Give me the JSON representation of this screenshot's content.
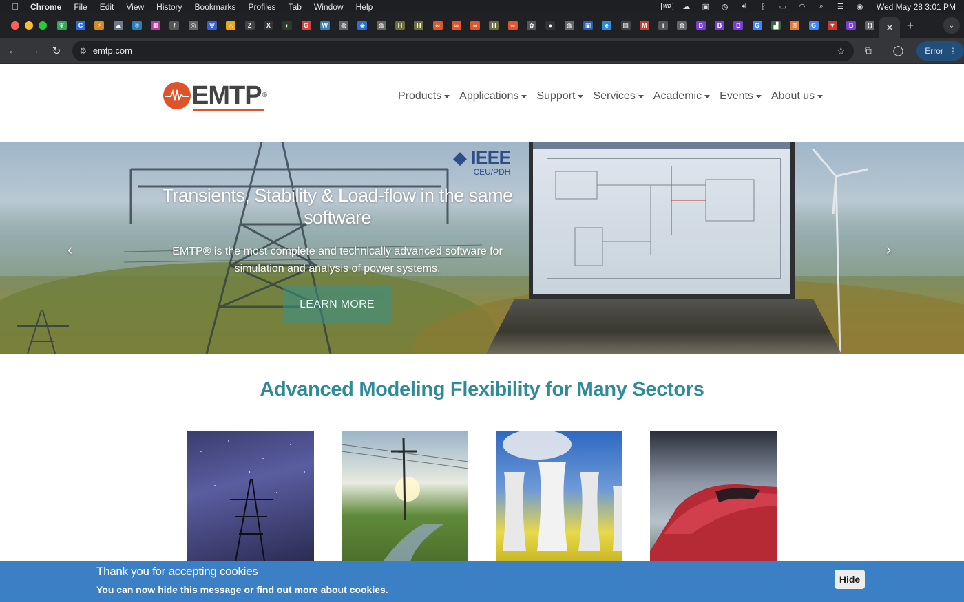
{
  "menubar": {
    "app": "Chrome",
    "items": [
      "File",
      "Edit",
      "View",
      "History",
      "Bookmarks",
      "Profiles",
      "Tab",
      "Window",
      "Help"
    ],
    "clock": "Wed May 28  3:01 PM",
    "wd_label": "WD"
  },
  "tabs": {
    "favicons": [
      {
        "icon": "leaf-icon",
        "color": "#3aa35c",
        "glyph": "❦"
      },
      {
        "icon": "c-icon",
        "color": "#2d6ce0",
        "glyph": "C"
      },
      {
        "icon": "bolt-icon",
        "color": "#d98a1e",
        "glyph": "⚡"
      },
      {
        "icon": "ghost-icon",
        "color": "#6f7a86",
        "glyph": "☁"
      },
      {
        "icon": "react-icon",
        "color": "#2a7fb8",
        "glyph": "⚛"
      },
      {
        "icon": "grid-icon",
        "color": "#b03fa0",
        "glyph": "▦"
      },
      {
        "icon": "slash-icon",
        "color": "#555555",
        "glyph": "/"
      },
      {
        "icon": "circle-icon",
        "color": "#666666",
        "glyph": "◎"
      },
      {
        "icon": "shield-icon",
        "color": "#3a60c9",
        "glyph": "⛨"
      },
      {
        "icon": "drive-icon",
        "color": "#e6a81e",
        "glyph": "△"
      },
      {
        "icon": "z-icon",
        "color": "#444444",
        "glyph": "Z"
      },
      {
        "icon": "x-icon",
        "color": "#333333",
        "glyph": "X"
      },
      {
        "icon": "dark-icon",
        "color": "#2c3a2c",
        "glyph": "◐"
      },
      {
        "icon": "gmail-icon",
        "color": "#d6453d",
        "glyph": "G"
      },
      {
        "icon": "wordpress-icon",
        "color": "#3c7fb0",
        "glyph": "W"
      },
      {
        "icon": "globe-icon",
        "color": "#666666",
        "glyph": "◍"
      },
      {
        "icon": "drop-icon",
        "color": "#2f6fd0",
        "glyph": "◈"
      },
      {
        "icon": "globe-icon",
        "color": "#666666",
        "glyph": "◍"
      },
      {
        "icon": "h-icon",
        "color": "#6d6d3d",
        "glyph": "H"
      },
      {
        "icon": "h-icon",
        "color": "#6d6d3d",
        "glyph": "H"
      },
      {
        "icon": "link-icon",
        "color": "#e0552c",
        "glyph": "∞"
      },
      {
        "icon": "link-icon",
        "color": "#e0552c",
        "glyph": "∞"
      },
      {
        "icon": "link-icon",
        "color": "#e0552c",
        "glyph": "∞"
      },
      {
        "icon": "h-icon",
        "color": "#6d6d3d",
        "glyph": "H"
      },
      {
        "icon": "link-icon",
        "color": "#e0552c",
        "glyph": "∞"
      },
      {
        "icon": "brain-icon",
        "color": "#555555",
        "glyph": "✿"
      },
      {
        "icon": "github-icon",
        "color": "#333333",
        "glyph": "●"
      },
      {
        "icon": "globe-icon",
        "color": "#666666",
        "glyph": "◍"
      },
      {
        "icon": "window-icon",
        "color": "#2b5fa8",
        "glyph": "▣"
      },
      {
        "icon": "edge-icon",
        "color": "#2a8bd8",
        "glyph": "e"
      },
      {
        "icon": "terminal-icon",
        "color": "#444444",
        "glyph": "▤"
      },
      {
        "icon": "gmail-icon",
        "color": "#c7402f",
        "glyph": "M"
      },
      {
        "icon": "info-icon",
        "color": "#555555",
        "glyph": "i"
      },
      {
        "icon": "globe-icon",
        "color": "#666666",
        "glyph": "◍"
      },
      {
        "icon": "bootstrap-icon",
        "color": "#7a3fd0",
        "glyph": "B"
      },
      {
        "icon": "bootstrap-icon",
        "color": "#7a3fd0",
        "glyph": "B"
      },
      {
        "icon": "bootstrap-icon",
        "color": "#7a3fd0",
        "glyph": "B"
      },
      {
        "icon": "google-icon",
        "color": "#4285f4",
        "glyph": "G"
      },
      {
        "icon": "chart-icon",
        "color": "#3a6a3a",
        "glyph": "▟"
      },
      {
        "icon": "stripes-icon",
        "color": "#e07a3a",
        "glyph": "▧"
      },
      {
        "icon": "google-icon",
        "color": "#4285f4",
        "glyph": "G"
      },
      {
        "icon": "gem-icon",
        "color": "#c9392b",
        "glyph": "▼"
      },
      {
        "icon": "bootstrap-icon",
        "color": "#7a3fd0",
        "glyph": "B"
      },
      {
        "icon": "code-icon",
        "color": "#666666",
        "glyph": "⟨⟩"
      }
    ],
    "close_glyph": "✕",
    "new_tab_glyph": "+"
  },
  "toolbar": {
    "url": "emtp.com",
    "error_label": "Error"
  },
  "site": {
    "logo_text": "EMTP",
    "logo_reg": "®",
    "nav": [
      "Products",
      "Applications",
      "Support",
      "Services",
      "Academic",
      "Events",
      "About us"
    ],
    "hero": {
      "ieee_big": "IEEE",
      "ieee_small": "CEU/PDH",
      "headline": "Transients, Stability & Load-flow in the same software",
      "subtext": "EMTP® is the most complete and technically advanced software for simulation and analysis of power systems.",
      "cta": "LEARN MORE",
      "prev_glyph": "‹",
      "next_glyph": "›"
    },
    "sectors_title": "Advanced Modeling Flexibility for Many Sectors"
  },
  "cookie": {
    "title": "Thank you for accepting cookies",
    "message": "You can now hide this message or find out more about cookies.",
    "hide_label": "Hide"
  },
  "colors": {
    "brand_orange": "#e0522a",
    "accent_teal": "#2f8a9a",
    "cookie_blue": "#3b7fc4"
  }
}
